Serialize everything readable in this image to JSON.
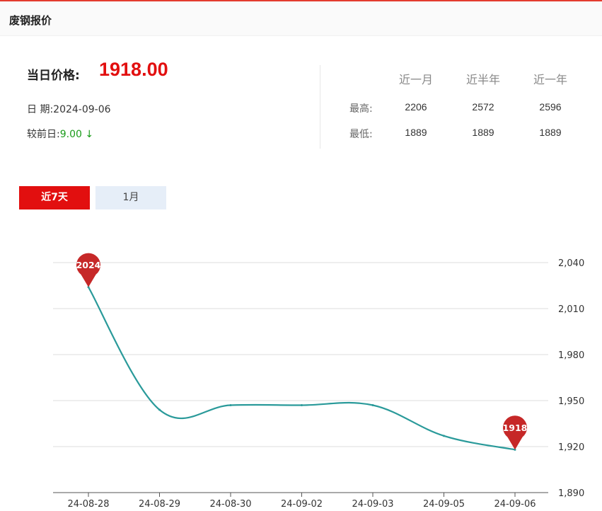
{
  "header": {
    "title": "废钢报价"
  },
  "summary": {
    "price_label": "当日价格:",
    "price_value": "1918.00",
    "date_label": "日 期:",
    "date_value": "2024-09-06",
    "change_label": "较前日:",
    "change_value": "9.00",
    "change_arrow": "↓",
    "change_color": "#1a9b1a"
  },
  "stats": {
    "columns": [
      "近一月",
      "近半年",
      "近一年"
    ],
    "rows": [
      {
        "label": "最高:",
        "values": [
          "2206",
          "2572",
          "2596"
        ]
      },
      {
        "label": "最低:",
        "values": [
          "1889",
          "1889",
          "1889"
        ]
      }
    ]
  },
  "tabs": [
    {
      "label": "近7天",
      "active": true
    },
    {
      "label": "1月",
      "active": false
    }
  ],
  "colors": {
    "accent": "#e20f0f",
    "line": "#2a9a9a",
    "marker": "#c62828"
  },
  "chart_data": {
    "type": "line",
    "categories": [
      "24-08-28",
      "24-08-29",
      "24-08-30",
      "24-09-02",
      "24-09-03",
      "24-09-05",
      "24-09-06"
    ],
    "series": [
      {
        "values": [
          2024,
          1944,
          1947,
          1947,
          1947,
          1927,
          1918
        ]
      }
    ],
    "ylim": [
      1890,
      2040
    ],
    "yticks": [
      1890,
      1920,
      1950,
      1980,
      2010,
      2040
    ],
    "ytick_labels": [
      "1,890",
      "1,920",
      "1,950",
      "1,980",
      "2,010",
      "2,040"
    ],
    "markers": [
      {
        "category": "24-08-28",
        "label": "2024"
      },
      {
        "category": "24-09-06",
        "label": "1918"
      }
    ],
    "grid": true,
    "y_axis_position": "right"
  }
}
